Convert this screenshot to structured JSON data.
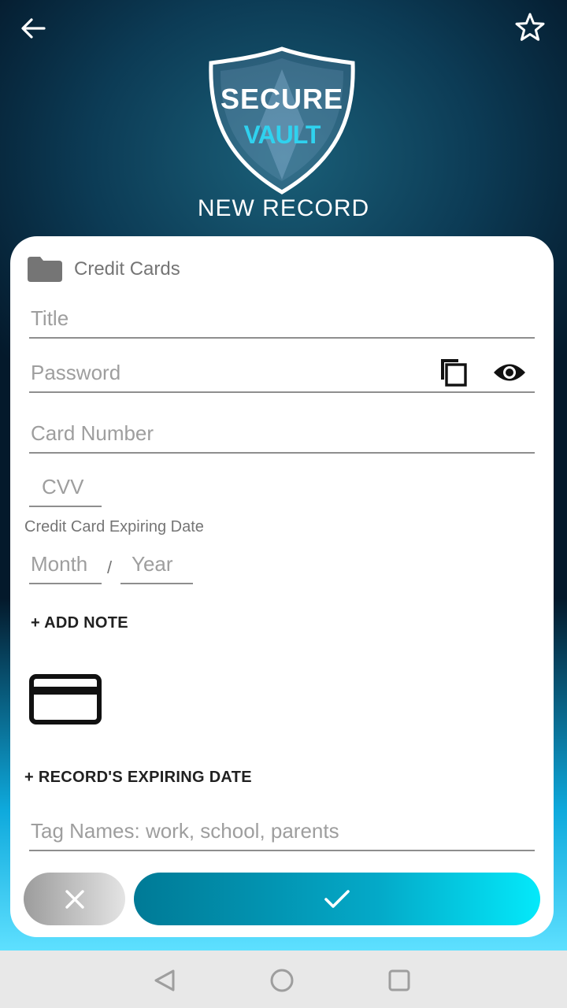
{
  "header": {
    "logo_line1": "SECURE",
    "logo_line2": "VAULT",
    "title": "NEW RECORD"
  },
  "form": {
    "category": "Credit Cards",
    "title_placeholder": "Title",
    "password_placeholder": "Password",
    "card_number_placeholder": "Card Number",
    "cvv_placeholder": "CVV",
    "expiring_date_label": "Credit Card Expiring Date",
    "month_placeholder": "Month",
    "date_separator": "/",
    "year_placeholder": "Year",
    "add_note": "+ ADD NOTE",
    "record_expiring_date": "+ RECORD'S EXPIRING DATE",
    "tags_placeholder": "Tag Names: work, school, parents"
  },
  "icons": {
    "back": "arrow-left",
    "favorite": "star-outline",
    "folder": "folder",
    "copy": "copy",
    "visibility": "eye",
    "card": "credit-card",
    "cancel": "close",
    "confirm": "check"
  },
  "colors": {
    "accent": "#04a9c8",
    "accent_light": "#04e9fa",
    "background_dark": "#04192b"
  }
}
